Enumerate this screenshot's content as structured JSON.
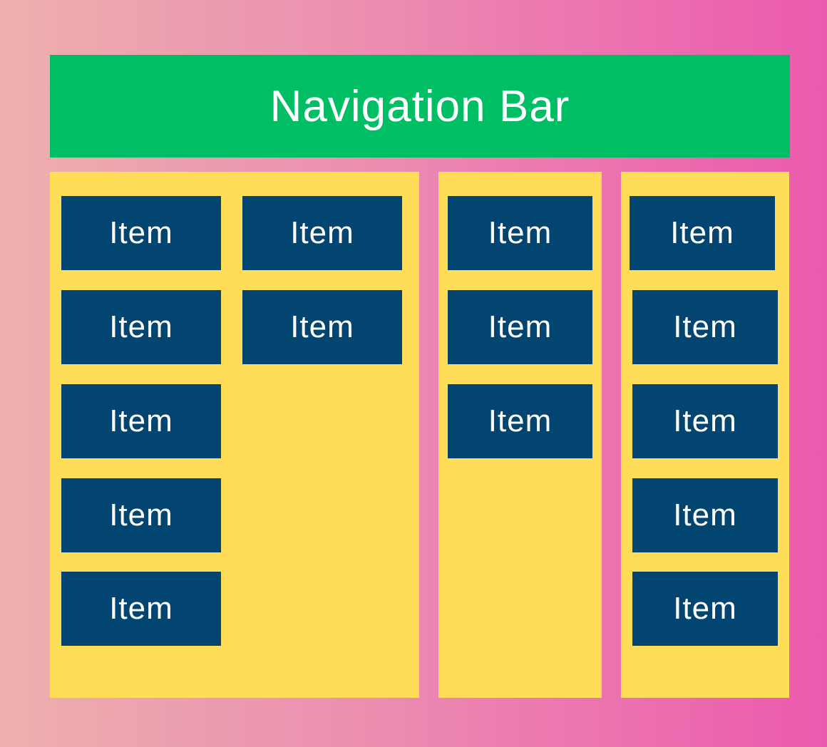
{
  "nav": {
    "label": "Navigation Bar"
  },
  "panels": [
    {
      "name": "panel-1",
      "items": [
        "Item",
        "Item",
        "Item",
        "Item",
        "Item",
        "Item",
        "Item"
      ]
    },
    {
      "name": "panel-2",
      "items": [
        "Item",
        "Item",
        "Item"
      ]
    },
    {
      "name": "panel-3",
      "items": [
        "Item",
        "Item",
        "Item",
        "Item",
        "Item"
      ]
    }
  ],
  "colors": {
    "nav": "#00be63",
    "panel": "#ffdd59",
    "item": "#014570",
    "background_start": "#edb0ae",
    "background_end": "#ec5aae"
  }
}
